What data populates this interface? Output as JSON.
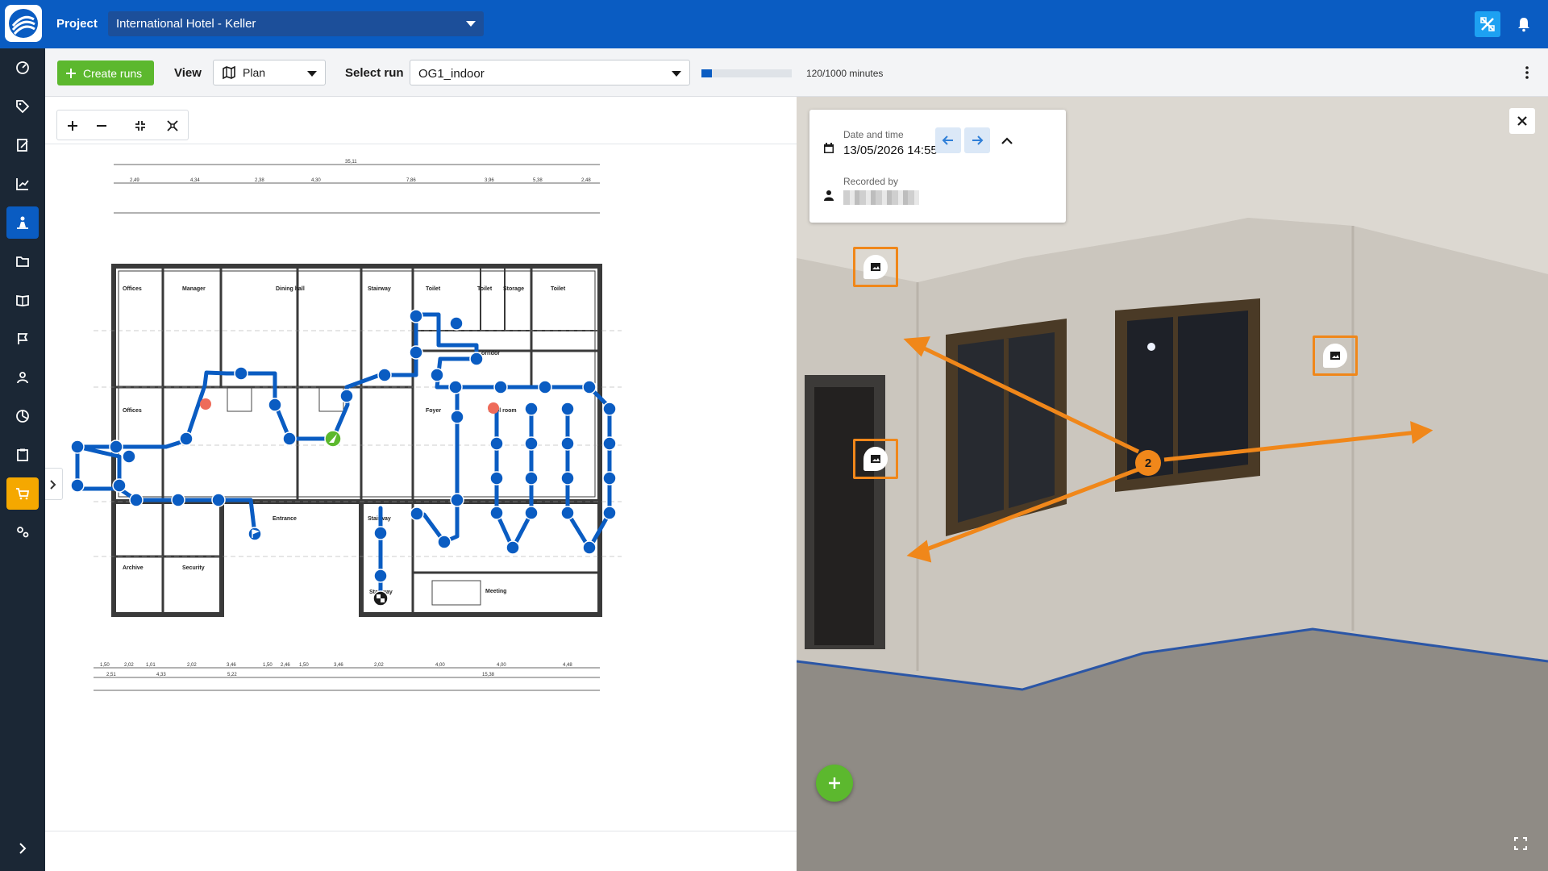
{
  "header": {
    "project_label": "Project",
    "project_value": "International Hotel - Keller"
  },
  "sidebar": {
    "items": [
      {
        "icon": "dashboard-icon"
      },
      {
        "icon": "tag-icon"
      },
      {
        "icon": "edit-document-icon"
      },
      {
        "icon": "chart-icon"
      },
      {
        "icon": "capture-person-icon",
        "active": true
      },
      {
        "icon": "folder-icon"
      },
      {
        "icon": "book-icon"
      },
      {
        "icon": "flag-icon"
      },
      {
        "icon": "person-icon"
      },
      {
        "icon": "pie-chart-icon"
      },
      {
        "icon": "clipboard-icon"
      },
      {
        "icon": "shopping-cart-icon",
        "highlight": "#f5a800"
      },
      {
        "icon": "settings-icon"
      }
    ]
  },
  "toolbar": {
    "create_runs_label": "Create runs",
    "view_label": "View",
    "view_value": "Plan",
    "select_run_label": "Select run",
    "run_value": "OG1_indoor",
    "progress_fraction": 0.12,
    "progress_text": "120/1000 minutes"
  },
  "plan": {
    "rooms": [
      "Offices",
      "Manager",
      "Dining hall",
      "Stairway",
      "Toilet",
      "Toilet",
      "Storage",
      "Toilet",
      "Offices",
      "Corridor",
      "Foyer",
      "Pool room",
      "Entrance",
      "Stairway",
      "Archive",
      "Security",
      "Meeting",
      "Stairway"
    ],
    "dimensions_top": [
      "35,11",
      "2,49",
      "4,34",
      "2,38",
      "4,30",
      "7,86",
      "3,96",
      "5,38",
      "2,48"
    ],
    "dimensions_bottom": [
      "1,50",
      "2,02",
      "1,01",
      "2,02",
      "3,46",
      "1,50",
      "2,46",
      "1,50",
      "3,46",
      "2,02",
      "4,00",
      "4,00",
      "4,48",
      "15,38",
      "5,22",
      "4,33",
      "2,51"
    ]
  },
  "viewer": {
    "date_label": "Date and time",
    "date_value": "13/05/2026 14:55",
    "recorded_label": "Recorded by",
    "recorded_value": "",
    "callout_count": "2",
    "accent": "#f0871a"
  },
  "colors": {
    "brand": "#0a5cc2",
    "route": "#0a5cc2",
    "success": "#5cb82e",
    "marker_red": "#ee6b5a"
  }
}
